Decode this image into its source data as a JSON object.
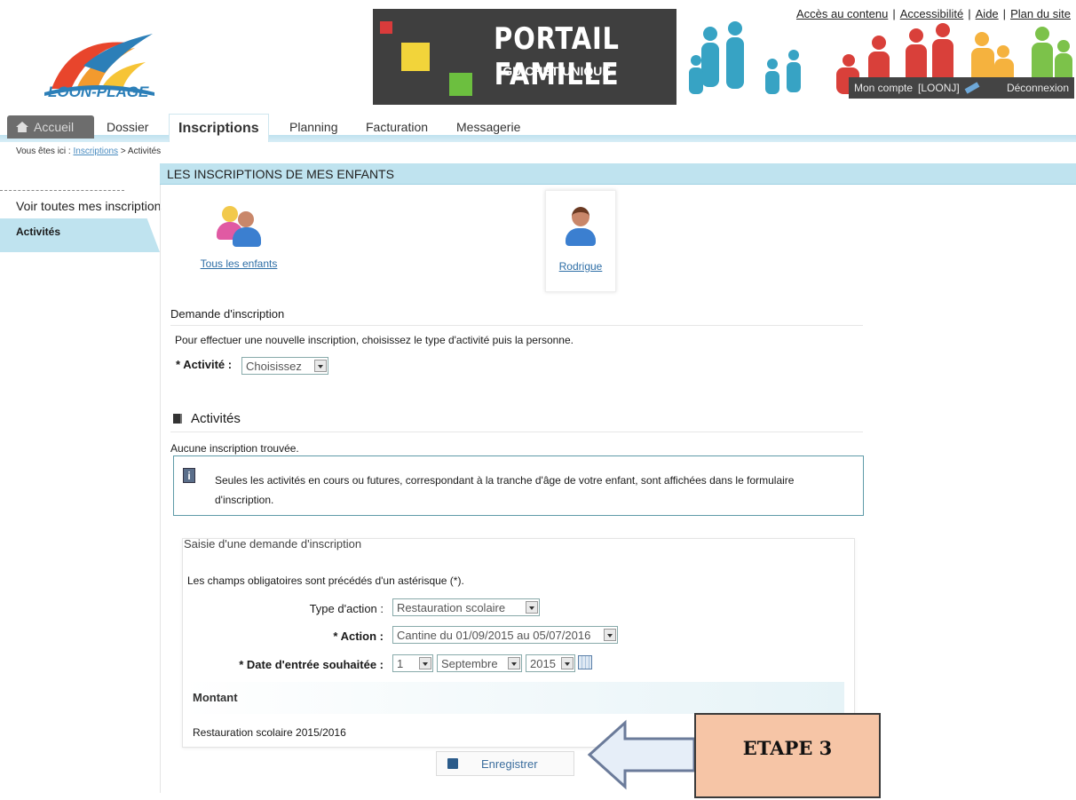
{
  "header": {
    "logo_text": "LOON-PLAGE",
    "banner_title": "PORTAIL FAMILLE",
    "banner_subtitle": "GUICHET UNIQUE",
    "top_links": [
      "Accès au contenu",
      "Accessibilité",
      "Aide",
      "Plan du site"
    ],
    "account_label": "Mon compte",
    "account_user": "[LOONJ]",
    "logout_label": "Déconnexion"
  },
  "nav": {
    "tabs": [
      "Accueil",
      "Dossier",
      "Inscriptions",
      "Planning",
      "Facturation",
      "Messagerie"
    ],
    "active": "Inscriptions"
  },
  "breadcrumb": {
    "prefix": "Vous êtes ici :",
    "link": "Inscriptions",
    "separator": ">",
    "current": "Activités"
  },
  "sidebar": {
    "items": [
      "Voir toutes mes inscriptions",
      "Activités"
    ]
  },
  "main": {
    "section_title": "LES INSCRIPTIONS DE MES ENFANTS",
    "children": [
      "Tous les enfants",
      "Rodrigue"
    ],
    "request_title": "Demande d'inscription",
    "request_text": "Pour effectuer une nouvelle inscription, choisissez le type d'activité puis la personne.",
    "activite_label": "* Activité :",
    "activite_value": "Choisissez",
    "activities_heading": "Activités",
    "none_found": "Aucune inscription trouvée.",
    "info_text": "Seules les activités en cours ou futures, correspondant à la tranche d'âge de votre enfant, sont affichées dans le formulaire d'inscription."
  },
  "form": {
    "title": "Saisie d'une demande d'inscription",
    "mandatory_note": "Les champs obligatoires sont précédés d'un astérisque (*).",
    "type_label": "Type d'action :",
    "type_value": "Restauration scolaire",
    "action_label": "* Action :",
    "action_value": "Cantine du 01/09/2015 au 05/07/2016",
    "date_label": "* Date d'entrée souhaitée :",
    "date_day": "1",
    "date_month": "Septembre",
    "date_year": "2015",
    "montant_label": "Montant",
    "montant_value": "Restauration scolaire 2015/2016",
    "save_label": "Enregistrer"
  },
  "callout": {
    "text": "ETAPE 3"
  },
  "colors": {
    "accent_light_blue": "#bfe3ef",
    "banner_dark": "#3f3f3f",
    "callout_fill": "#f6c5a6",
    "link_blue": "#2e6ea6"
  }
}
